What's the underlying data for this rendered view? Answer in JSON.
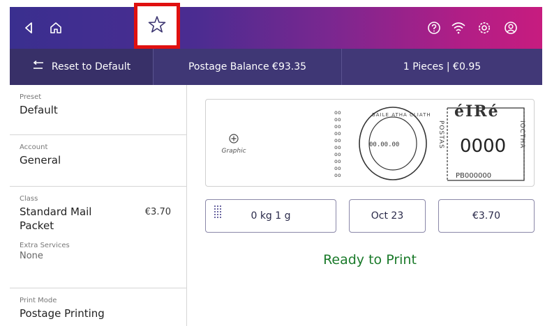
{
  "topbar": {
    "icons": [
      "back-icon",
      "home-icon",
      "help-icon",
      "wifi-icon",
      "settings-icon",
      "user-icon"
    ]
  },
  "subbar": {
    "reset_label": "Reset to Default",
    "balance_label": "Postage Balance €93.35",
    "pieces_label": "1 Pieces | €0.95"
  },
  "sidebar": {
    "preset_label": "Preset",
    "preset_value": "Default",
    "account_label": "Account",
    "account_value": "General",
    "class_label": "Class",
    "class_value_line1": "Standard Mail",
    "class_value_line2": "Packet",
    "class_price": "€3.70",
    "extra_label": "Extra Services",
    "extra_value": "None",
    "print_mode_label": "Print Mode",
    "print_mode_value": "Postage Printing"
  },
  "stamp": {
    "graphic_label": "Graphic",
    "postmark_date": "00.00.00",
    "postmark_text": "BAILE ATHA CLIATH",
    "country": "éIRé",
    "amount": "0000",
    "pb_number": "PB000000",
    "side_left": "POSTAS",
    "side_right": "IOCTHA"
  },
  "controls": {
    "weight": "0 kg 1 g",
    "date": "Oct 23",
    "amount": "€3.70"
  },
  "status": "Ready to Print",
  "colors": {
    "topbar_start": "#3a2f8f",
    "topbar_end": "#c71c7f",
    "subbar": "#3b3470",
    "ready_green": "#1a7a2a",
    "highlight_red": "#e01010"
  }
}
